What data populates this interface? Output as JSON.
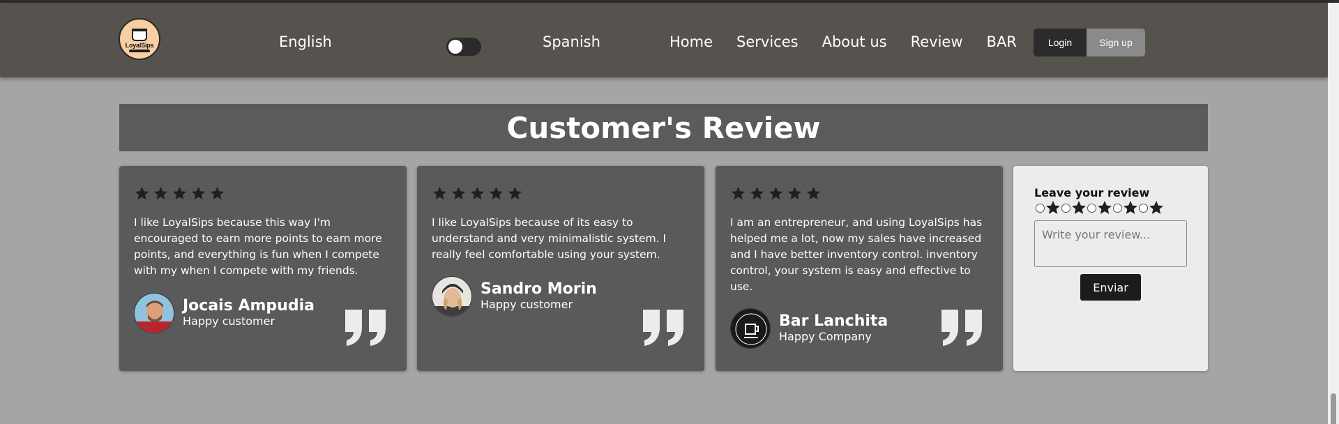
{
  "nav": {
    "logo_text": "LoyalSips",
    "lang_en": "English",
    "lang_es": "Spanish",
    "links": [
      "Home",
      "Services",
      "About us",
      "Review",
      "BAR"
    ],
    "login": "Login",
    "signup": "Sign up"
  },
  "section": {
    "title": "Customer's Review"
  },
  "reviews": [
    {
      "stars": 5,
      "text": "I like LoyalSips because this way I'm encouraged to earn more points to earn more points, and everything is fun when I compete with my when I compete with my friends.",
      "name": "Jocais Ampudia",
      "role": "Happy customer"
    },
    {
      "stars": 5,
      "text": "I like LoyalSips because of its easy to understand and very minimalistic system. I really feel comfortable using your system.",
      "name": "Sandro Morin",
      "role": "Happy customer"
    },
    {
      "stars": 5,
      "text": "I am an entrepreneur, and using LoyalSips has helped me a lot, now my sales have increased and I have better inventory control. inventory control, your system is easy and effective to use.",
      "name": "Bar Lanchita",
      "role": "Happy Company"
    }
  ],
  "form": {
    "title": "Leave your review",
    "placeholder": "Write your review...",
    "submit": "Enviar",
    "rating_options": 5
  },
  "colors": {
    "navbar": "#56524d",
    "page_bg": "#a5a5a5",
    "card_bg": "#5a5a5a",
    "form_bg": "#ececec"
  },
  "icons": [
    "star-icon",
    "quote-icon",
    "toggle-switch",
    "radio-button"
  ]
}
